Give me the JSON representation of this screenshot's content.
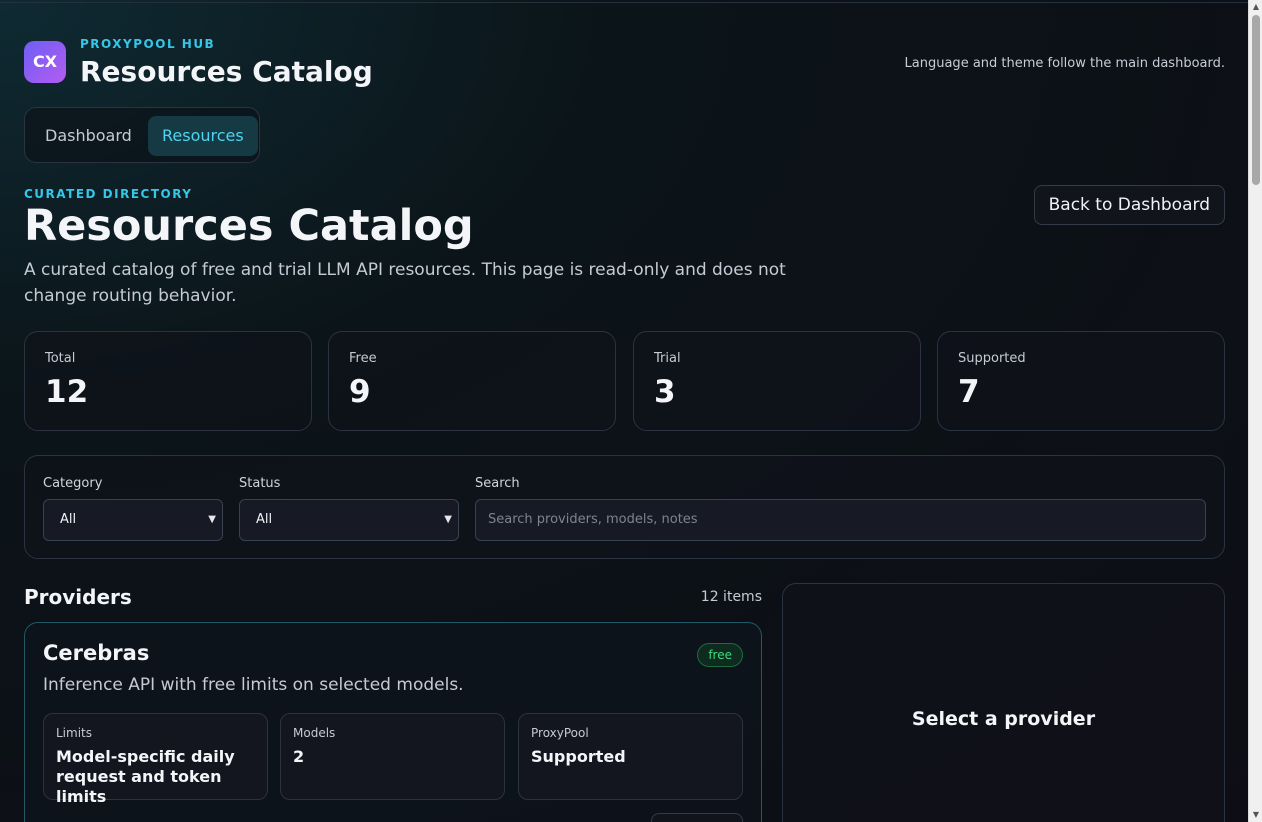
{
  "header": {
    "logo_text": "CX",
    "brand": "PROXYPOOL HUB",
    "title": "Resources Catalog",
    "note": "Language and theme follow the main dashboard."
  },
  "nav": {
    "tabs": [
      {
        "label": "Dashboard",
        "active": false
      },
      {
        "label": "Resources",
        "active": true
      }
    ]
  },
  "hero": {
    "eyebrow": "CURATED DIRECTORY",
    "title": "Resources Catalog",
    "description": "A curated catalog of free and trial LLM API resources. This page is read-only and does not change routing behavior.",
    "back_button": "Back to Dashboard"
  },
  "stats": [
    {
      "label": "Total",
      "value": "12"
    },
    {
      "label": "Free",
      "value": "9"
    },
    {
      "label": "Trial",
      "value": "3"
    },
    {
      "label": "Supported",
      "value": "7"
    }
  ],
  "filters": {
    "category_label": "Category",
    "category_value": "All",
    "status_label": "Status",
    "status_value": "All",
    "search_label": "Search",
    "search_placeholder": "Search providers, models, notes"
  },
  "providers": {
    "title": "Providers",
    "count": "12 items",
    "cards": [
      {
        "name": "Cerebras",
        "badge": "free",
        "description": "Inference API with free limits on selected models.",
        "stats": [
          {
            "label": "Limits",
            "value": "Model-specific daily request and token limits"
          },
          {
            "label": "Models",
            "value": "2"
          },
          {
            "label": "ProxyPool",
            "value": "Supported"
          }
        ]
      }
    ]
  },
  "detail": {
    "empty_text": "Select a provider"
  },
  "colors": {
    "accent": "#35c6e8",
    "badge_free": "#3fdc7b",
    "logo_start": "#6d5ef5",
    "logo_end": "#b45cf0"
  }
}
